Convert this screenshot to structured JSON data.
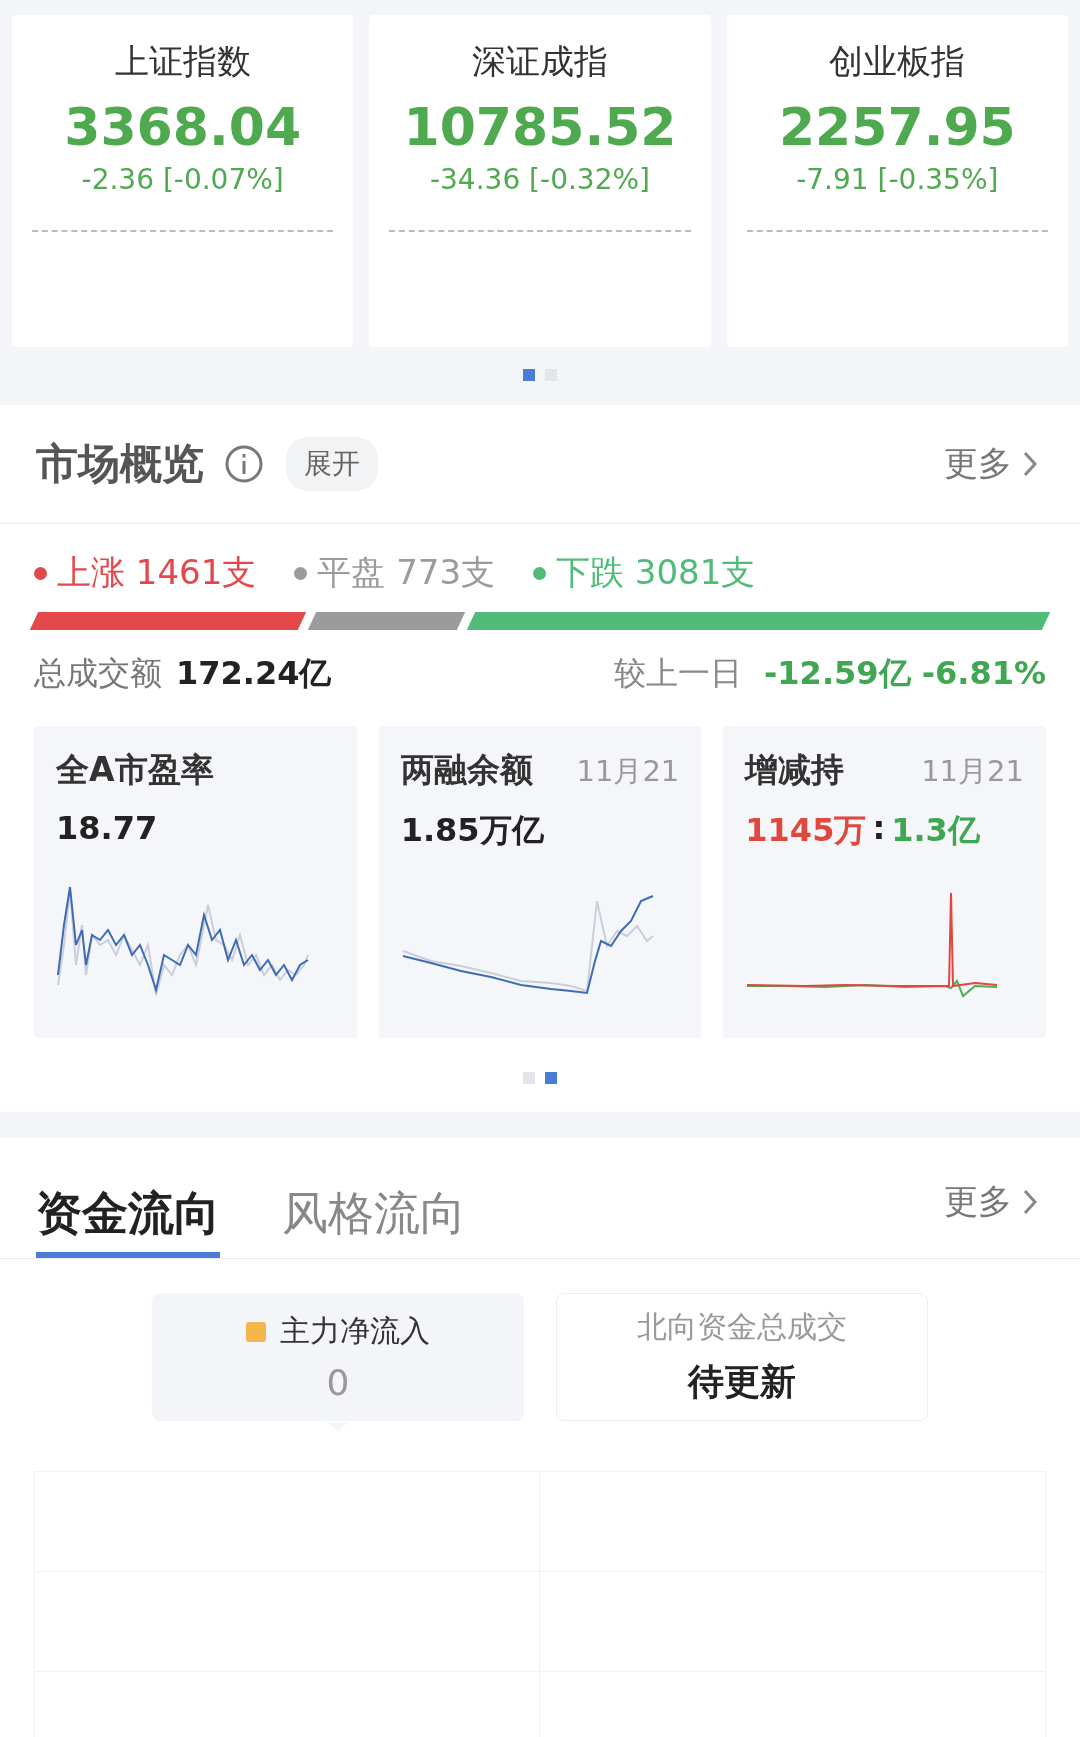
{
  "indices": [
    {
      "name": "上证指数",
      "value": "3368.04",
      "change": "-2.36 [-0.07%]"
    },
    {
      "name": "深证成指",
      "value": "10785.52",
      "change": "-34.36 [-0.32%]"
    },
    {
      "name": "创业板指",
      "value": "2257.95",
      "change": "-7.91 [-0.35%]"
    }
  ],
  "index_pager": [
    {
      "selected": true
    },
    {
      "selected": false
    }
  ],
  "market_overview": {
    "title": "市场概览",
    "expand_button": "展开",
    "more_link": "更多",
    "breadth": [
      {
        "label": "上涨 1461支",
        "color": "#e5484a"
      },
      {
        "label": "平盘 773支",
        "color": "#9b9b9b"
      },
      {
        "label": "下跌 3081支",
        "color": "#52bb78"
      }
    ],
    "turnover_label": "总成交额",
    "turnover_value": "172.24亿",
    "compare_label": "较上一日",
    "compare_value": "-12.59亿 -6.81%",
    "mini_cards": [
      {
        "title": "全A市盈率",
        "value_parts": [
          {
            "text": "18.77",
            "color": "#222222"
          }
        ],
        "kind": "pe"
      },
      {
        "title": "两融余额",
        "date": "11月21",
        "value_parts": [
          {
            "text": "1.85万亿",
            "color": "#222222"
          }
        ],
        "kind": "margin"
      },
      {
        "title": "增减持",
        "date": "11月21",
        "value_parts": [
          {
            "text": "1145万",
            "color": "#e0483f"
          },
          {
            "text": ":",
            "color": "#222222"
          },
          {
            "text": "1.3亿",
            "color": "#3fa752"
          }
        ],
        "kind": "holding"
      }
    ],
    "card_pager": [
      {
        "selected": false
      },
      {
        "selected": true
      }
    ]
  },
  "fund_flow": {
    "tabs": [
      {
        "label": "资金流向",
        "selected": true
      },
      {
        "label": "风格流向",
        "selected": false
      }
    ],
    "more_link": "更多",
    "cards": [
      {
        "label": "主力净流入",
        "value": "0",
        "color": "#f3b54c",
        "selected": true
      },
      {
        "label": "北向资金总成交",
        "value": "待更新",
        "selected": false
      }
    ]
  }
}
